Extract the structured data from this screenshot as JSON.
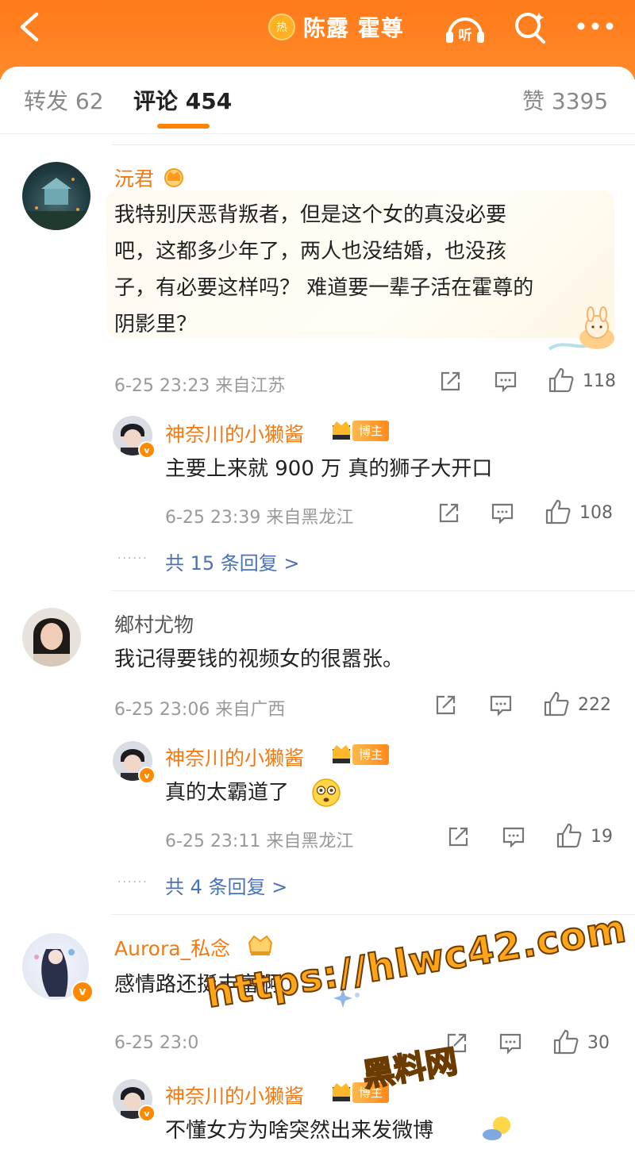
{
  "header": {
    "title": "陈露 霍尊",
    "hot_badge": "热",
    "listen_label": "听"
  },
  "tabs": {
    "repost": "转发 62",
    "comments": "评论 454",
    "likes": "赞 3395"
  },
  "comments": [
    {
      "user": "沅君",
      "text": "我特别厌恶背叛者，但是这个女的真没必要吧，这都多少年了，两人也没结婚，也没孩子，有必要这样吗？ 难道要一辈子活在霍尊的阴影里？",
      "text_lines": [
        "我特别厌恶背叛者，但是这个女的真没必要",
        "吧，这都多少年了，两人也没结婚，也没孩",
        "子，有必要这样吗？ 难道要一辈子活在霍尊的",
        "阴影里？"
      ],
      "meta": "6-25 23:23 来自江苏",
      "likes": "118",
      "reply": {
        "user": "神奈川的小獭酱",
        "tag": "博主",
        "text": "主要上来就 900 万 真的狮子大开口",
        "meta": "6-25 23:39 来自黑龙江",
        "likes": "108"
      },
      "more_replies": "共 15 条回复 >"
    },
    {
      "user": "鄉村尤物",
      "text": "我记得要钱的视频女的很嚣张。",
      "meta": "6-25 23:06 来自广西",
      "likes": "222",
      "reply": {
        "user": "神奈川的小獭酱",
        "tag": "博主",
        "text": "真的太霸道了",
        "meta": "6-25 23:11 来自黑龙江",
        "likes": "19"
      },
      "more_replies": "共 4 条回复 >"
    },
    {
      "user": "Aurora_私念",
      "text": "感情路还挺丰富啊",
      "meta": "6-25 23:0",
      "likes": "30",
      "reply": {
        "user": "神奈川的小獭酱",
        "tag": "博主",
        "text": "不懂女方为啥突然出来发微博"
      }
    }
  ],
  "watermark": {
    "line1": "https://hlwc42.com",
    "line2": "黑料网"
  },
  "colors": {
    "brand": "#ff8200",
    "username": "#f07a14",
    "link": "#4a72b8"
  }
}
